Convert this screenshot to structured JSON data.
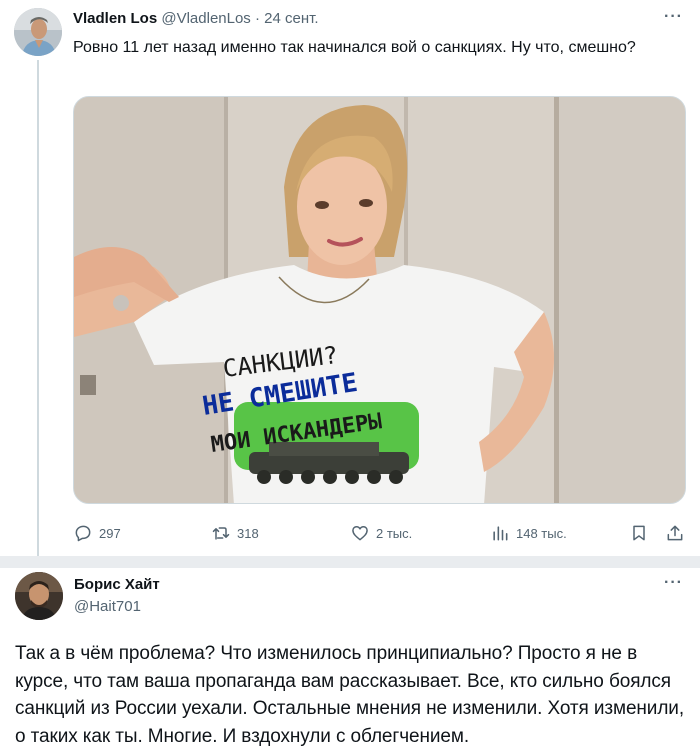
{
  "tweet1": {
    "author_name": "Vladlen Los",
    "handle": "@VladlenLos",
    "separator": "·",
    "time": "24 сент.",
    "more_label": "···",
    "text": "Ровно 11 лет назад именно так начинался вой о санкциях. Ну что, смешно?",
    "media": {
      "shirt_line1": "САНКЦИИ?",
      "shirt_line2": "НЕ СМЕШИТЕ",
      "shirt_line3": "МОИ ИСКАНДЕРЫ"
    },
    "actions": {
      "replies": "297",
      "reposts": "318",
      "likes": "2 тыс.",
      "views": "148 тыс."
    },
    "icons": [
      "reply-icon",
      "repost-icon",
      "like-icon",
      "views-icon",
      "bookmark-icon",
      "share-icon"
    ]
  },
  "tweet2": {
    "author_name": "Борис Хайт",
    "handle": "@Hait701",
    "more_label": "···",
    "text": "Так а в чём проблема? Что изменилось принципиально? Просто я не в курсе, что там ваша пропаганда вам рассказывает. Все, кто сильно боялся санкций из России уехали. Остальные мнения не изменили. Хотя изменили, о таких как ты. Многие. И вздохнули с облегчением."
  },
  "colors": {
    "text": "#0f1419",
    "secondary": "#536471",
    "border": "#cfd9de",
    "separator_bg": "#e9ecef",
    "shirt_green": "#4fc13d"
  }
}
